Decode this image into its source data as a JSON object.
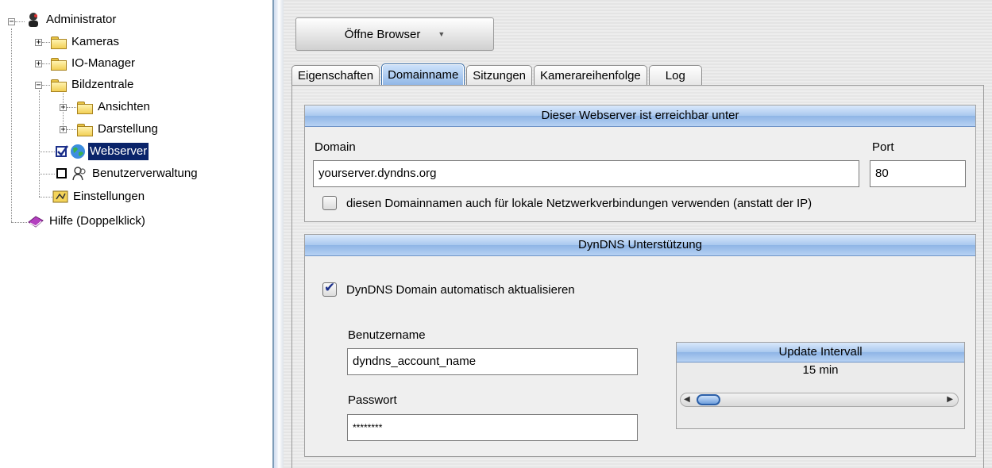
{
  "tree": {
    "root": "Administrator",
    "items": [
      {
        "label": "Kameras"
      },
      {
        "label": "IO-Manager"
      },
      {
        "label": "Bildzentrale"
      },
      {
        "label": "Ansichten"
      },
      {
        "label": "Darstellung"
      },
      {
        "label": "Webserver"
      },
      {
        "label": "Benutzerverwaltung"
      },
      {
        "label": "Einstellungen"
      },
      {
        "label": "Hilfe (Doppelklick)"
      }
    ]
  },
  "toolbar": {
    "browser_button": "Öffne Browser"
  },
  "tabs": [
    "Eigenschaften",
    "Domainname",
    "Sitzungen",
    "Kamerareihenfolge",
    "Log"
  ],
  "active_tab": "Domainname",
  "webserver": {
    "header": "Dieser Webserver ist erreichbar unter",
    "domain_label": "Domain",
    "domain_value": "yourserver.dyndns.org",
    "port_label": "Port",
    "port_value": "80",
    "local_checkbox_label": "diesen Domainnamen auch für lokale Netzwerkverbindungen verwenden (anstatt der IP)",
    "local_checkbox_checked": false
  },
  "dyndns": {
    "header": "DynDNS Unterstützung",
    "auto_update_label": "DynDNS Domain automatisch aktualisieren",
    "auto_update_checked": true,
    "username_label": "Benutzername",
    "username_value": "dyndns_account_name",
    "password_label": "Passwort",
    "password_value": "********",
    "interval": {
      "header": "Update Intervall",
      "value_text": "15 min"
    }
  },
  "colors": {
    "accent": "#8fb5e6",
    "selection": "#0a246a"
  }
}
